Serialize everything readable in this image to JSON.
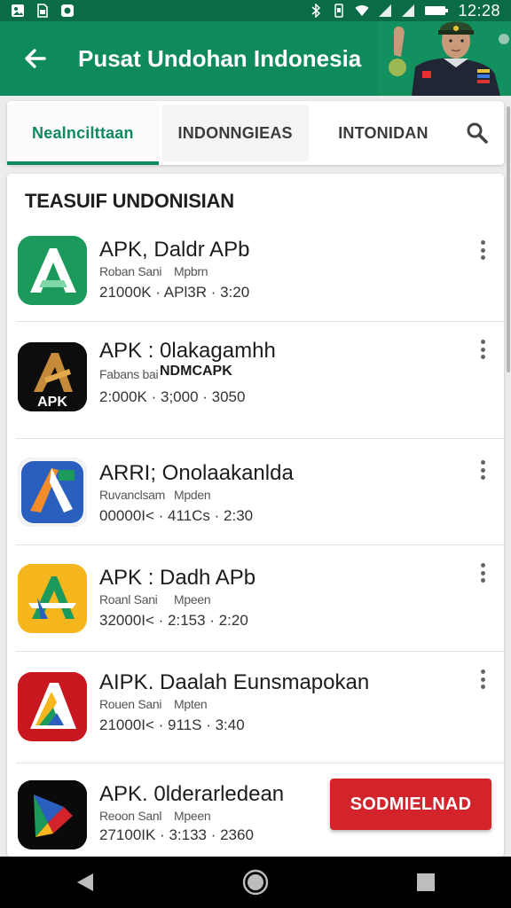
{
  "status": {
    "time": "12:28",
    "icons_left": [
      "image-icon",
      "sim-icon",
      "media-icon"
    ],
    "icons_right": [
      "bluetooth-icon",
      "vibrate-icon",
      "wifi-icon",
      "signal-icon",
      "signal-icon",
      "battery-icon"
    ]
  },
  "appbar": {
    "title": "Pusat Undohan Indonesia",
    "back_icon": "arrow-left-icon",
    "accent": "#0f8a5c"
  },
  "tabs": [
    {
      "label": "Nealncilttaan",
      "selected": true
    },
    {
      "label": "INDONNGIEAS",
      "selected": false
    },
    {
      "label": "INTONIDAN",
      "selected": false
    }
  ],
  "search_icon": "search-icon",
  "section": {
    "title": "TEASUIF UNDONISIAN"
  },
  "apps": [
    {
      "name": "APK, Daldr APb",
      "sub": "Roban Sani",
      "sub_b": "Mpbrn",
      "sub2": "",
      "meta": "21000K · APl3R · 3:20",
      "icon_bg": "#1c9a5c"
    },
    {
      "name": "APK : 0lakagamhh",
      "sub": "Fabans bai",
      "sub_b": "",
      "sub2": "NDMCAPK",
      "meta": "2:000K · 3;000 · 3050",
      "icon_bg": "#0d0d0d"
    },
    {
      "name": "ARRI; Onolaakanlda",
      "sub": "Ruvanclsam",
      "sub_b": "Mpden",
      "sub2": "",
      "meta": "00000I< · 411Cs · 2:30",
      "icon_bg": "#2a5fc0"
    },
    {
      "name": "APK : Dadh APb",
      "sub": "Roanl Sani",
      "sub_b": "Mpeen",
      "sub2": "",
      "meta": "32000I< · 2:153 · 2:20",
      "icon_bg": "#f6b71e"
    },
    {
      "name": "AIPK. Daalah Eunsmapokan",
      "sub": "Rouen Sani",
      "sub_b": "Mpten",
      "sub2": "",
      "meta": "21000I< · 911S · 3:40",
      "icon_bg": "#c8171f"
    },
    {
      "name": "APK. 0lderarledean",
      "sub": "Reoon Sanl",
      "sub_b": "Mpeen",
      "sub2": "",
      "meta": "27100IK · 3:133 · 2360",
      "icon_bg": "#0a0a0a"
    }
  ],
  "install_button": {
    "label": "SODMIELNAD",
    "color": "#d3232b"
  },
  "navbar": {
    "back": "back-triangle-icon",
    "home": "home-circle-icon",
    "recents": "recents-square-icon"
  }
}
